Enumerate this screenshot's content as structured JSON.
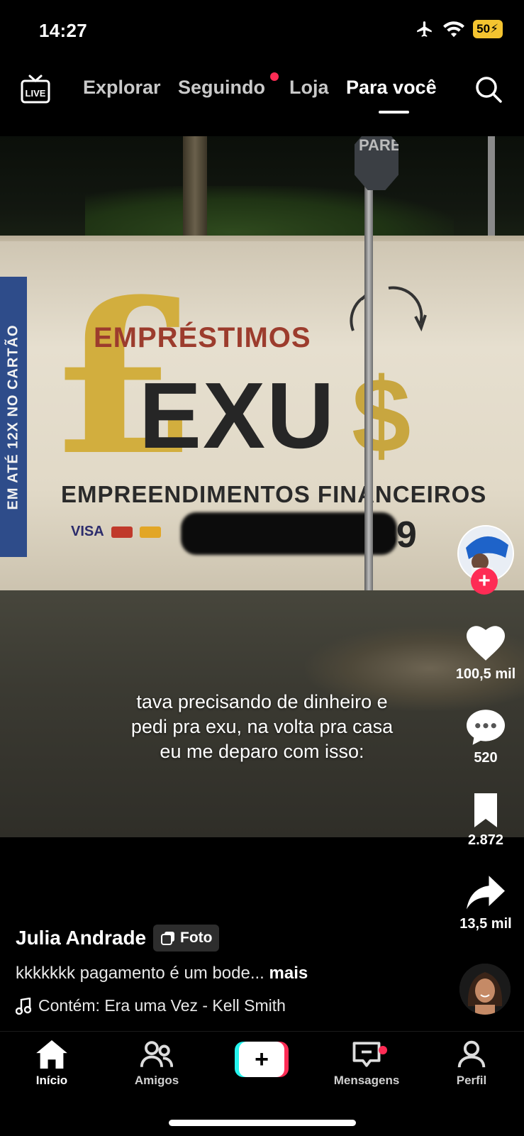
{
  "status_bar": {
    "time": "14:27",
    "battery": "50",
    "icons": [
      "airplane-icon",
      "wifi-icon",
      "charging-bolt-icon"
    ]
  },
  "top_nav": {
    "tabs": [
      {
        "label": "Explorar",
        "active": false
      },
      {
        "label": "Seguindo",
        "active": false,
        "has_dot": true
      },
      {
        "label": "Loja",
        "active": false
      },
      {
        "label": "Para você",
        "active": true
      }
    ],
    "live_label": "LIVE",
    "accent": "#fe2c55"
  },
  "post": {
    "sign": {
      "vertical_text": "EM ATÉ 12X NO CARTÃO",
      "line1": "EMPRÉSTIMOS",
      "pound": "£",
      "brand": "EXU",
      "dollar": "$",
      "line3": "EMPREENDIMENTOS FINANCEIROS",
      "card_visa": "VISA",
      "phone_visible": "89",
      "stop_sign": "PARE"
    },
    "caption_lines": [
      "tava precisando de dinheiro e",
      "pedi pra exu, na volta pra casa",
      "eu me deparo com isso:"
    ],
    "author": "Julia Andrade",
    "badge": "Foto",
    "description": "kkkkkkk pagamento é um bode...",
    "more": "mais",
    "music": "Contém: Era uma Vez - Kell Smith"
  },
  "rail": {
    "likes": "100,5 mil",
    "comments": "520",
    "saves": "2.872",
    "shares": "13,5 mil",
    "follow_plus": "+"
  },
  "bottom_nav": {
    "items": [
      {
        "label": "Início",
        "icon": "home-icon",
        "active": true
      },
      {
        "label": "Amigos",
        "icon": "friends-icon",
        "active": false
      },
      {
        "label": "Mensagens",
        "icon": "inbox-icon",
        "active": false,
        "has_dot": true
      },
      {
        "label": "Perfil",
        "icon": "profile-icon",
        "active": false
      }
    ],
    "create_label": "+"
  }
}
